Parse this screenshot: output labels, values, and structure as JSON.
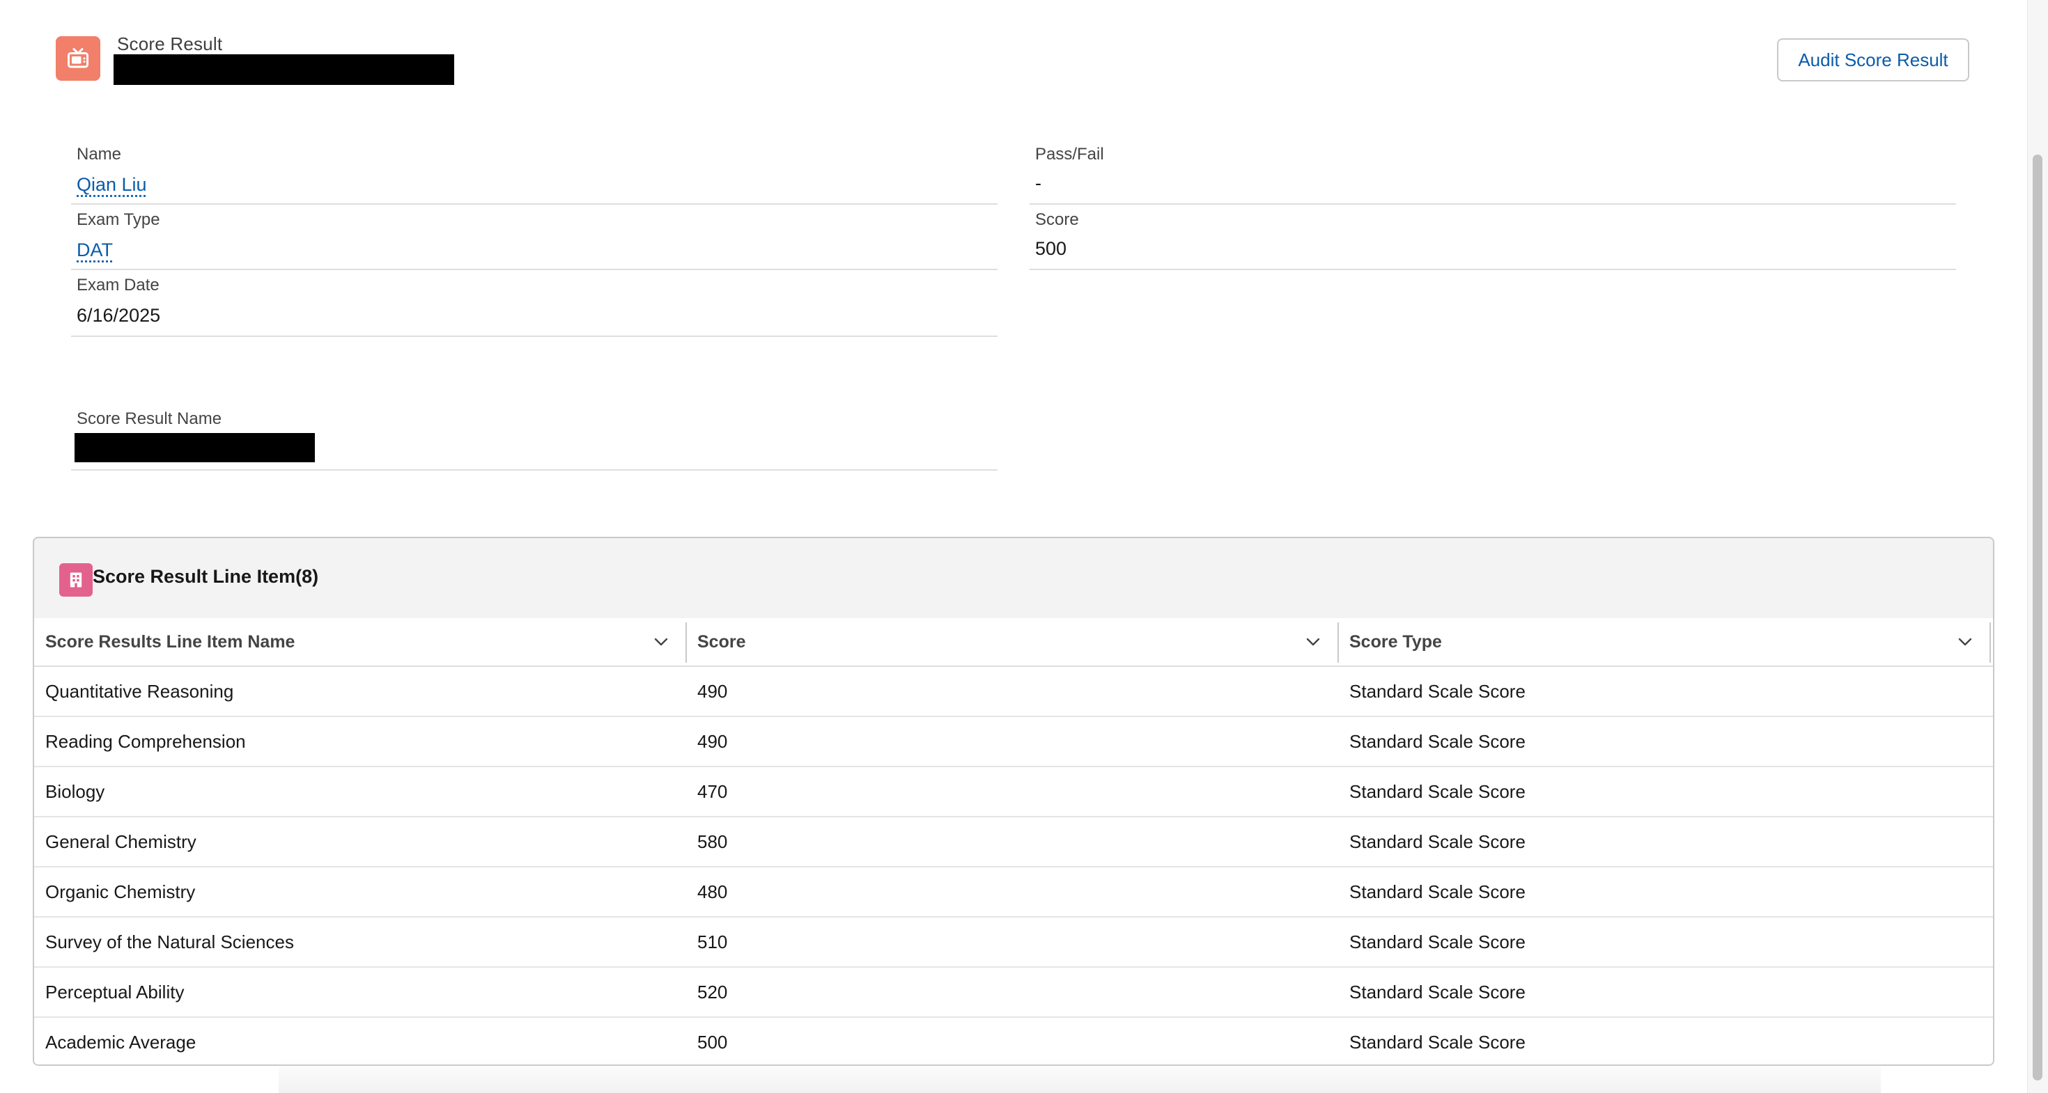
{
  "header": {
    "object_label": "Score Result",
    "action_button": "Audit Score Result",
    "icon": "tv-icon"
  },
  "fields": {
    "name": {
      "label": "Name",
      "value": "Qian Liu"
    },
    "exam_type": {
      "label": "Exam Type",
      "value": "DAT"
    },
    "exam_date": {
      "label": "Exam Date",
      "value": "6/16/2025"
    },
    "pass_fail": {
      "label": "Pass/Fail",
      "value": "-"
    },
    "score": {
      "label": "Score",
      "value": "500"
    },
    "score_result_name": {
      "label": "Score Result Name"
    }
  },
  "related_list": {
    "title": "Score Result Line Item(8)",
    "icon": "building-icon",
    "columns": [
      "Score Results Line Item Name",
      "Score",
      "Score Type"
    ],
    "rows": [
      [
        "Quantitative Reasoning",
        "490",
        "Standard Scale Score"
      ],
      [
        "Reading Comprehension",
        "490",
        "Standard Scale Score"
      ],
      [
        "Biology",
        "470",
        "Standard Scale Score"
      ],
      [
        "General Chemistry",
        "580",
        "Standard Scale Score"
      ],
      [
        "Organic Chemistry",
        "480",
        "Standard Scale Score"
      ],
      [
        "Survey of the Natural Sciences",
        "510",
        "Standard Scale Score"
      ],
      [
        "Perceptual Ability",
        "520",
        "Standard Scale Score"
      ],
      [
        "Academic Average",
        "500",
        "Standard Scale Score"
      ]
    ]
  },
  "colors": {
    "header_icon_bg": "#f17f6a",
    "list_icon_bg": "#e3628d",
    "link": "#0b5cab"
  }
}
